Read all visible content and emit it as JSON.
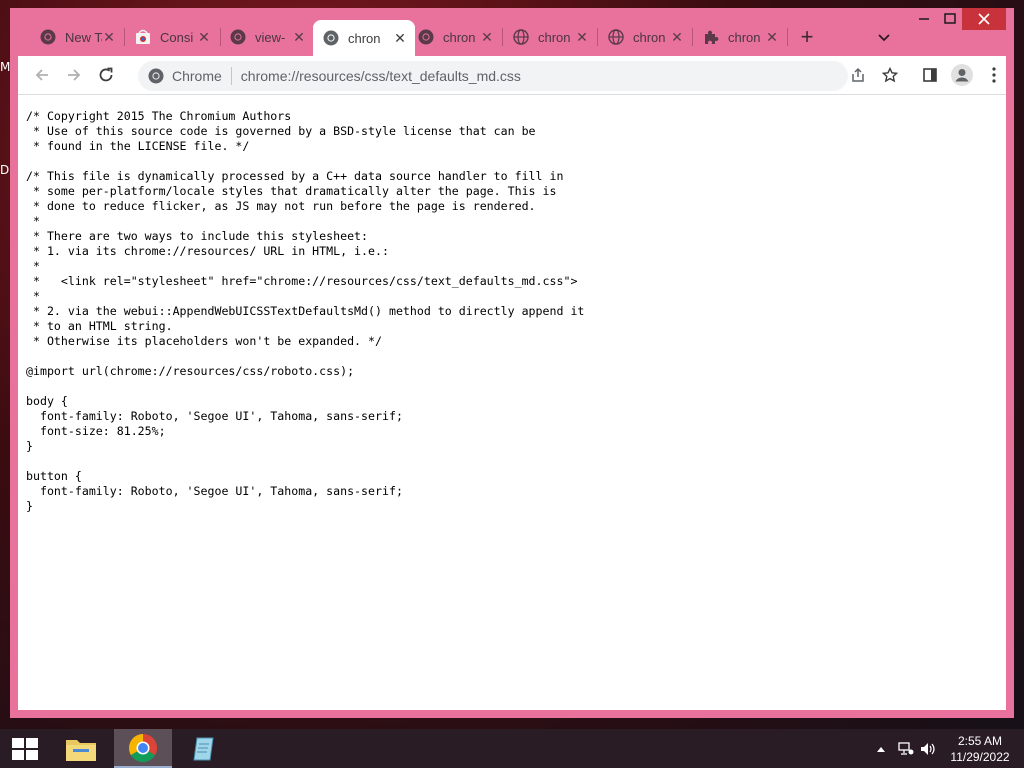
{
  "desktop": {
    "letters": [
      "M",
      "D"
    ]
  },
  "tabs": [
    {
      "label": "New Tab",
      "icon": "chrome-icon",
      "active": false
    },
    {
      "label": "Consi",
      "icon": "chrome-web-store-icon",
      "active": false
    },
    {
      "label": "view-",
      "icon": "chrome-icon",
      "active": false
    },
    {
      "label": "chron",
      "icon": "chrome-icon",
      "active": true
    },
    {
      "label": "chron",
      "icon": "chrome-icon",
      "active": false
    },
    {
      "label": "chron",
      "icon": "globe-icon",
      "active": false
    },
    {
      "label": "chron",
      "icon": "globe-icon",
      "active": false
    },
    {
      "label": "chron",
      "icon": "puzzle-icon",
      "active": false
    }
  ],
  "omnibox": {
    "chip": "Chrome",
    "url": "chrome://resources/css/text_defaults_md.css"
  },
  "page": {
    "code": "/* Copyright 2015 The Chromium Authors\n * Use of this source code is governed by a BSD-style license that can be\n * found in the LICENSE file. */\n\n/* This file is dynamically processed by a C++ data source handler to fill in\n * some per-platform/locale styles that dramatically alter the page. This is\n * done to reduce flicker, as JS may not run before the page is rendered.\n *\n * There are two ways to include this stylesheet:\n * 1. via its chrome://resources/ URL in HTML, i.e.:\n *\n *   <link rel=\"stylesheet\" href=\"chrome://resources/css/text_defaults_md.css\">\n *\n * 2. via the webui::AppendWebUICSSTextDefaultsMd() method to directly append it\n * to an HTML string.\n * Otherwise its placeholders won't be expanded. */\n\n@import url(chrome://resources/css/roboto.css);\n\nbody {\n  font-family: Roboto, 'Segoe UI', Tahoma, sans-serif;\n  font-size: 81.25%;\n}\n\nbutton {\n  font-family: Roboto, 'Segoe UI', Tahoma, sans-serif;\n}"
  },
  "taskbar": {
    "apps": [
      {
        "name": "file-explorer"
      },
      {
        "name": "chrome",
        "active": true
      },
      {
        "name": "notepad"
      }
    ],
    "time": "2:55 AM",
    "date": "11/29/2022"
  },
  "colors": {
    "frame": "#e8729b",
    "taskbar": "#2a1c24"
  }
}
